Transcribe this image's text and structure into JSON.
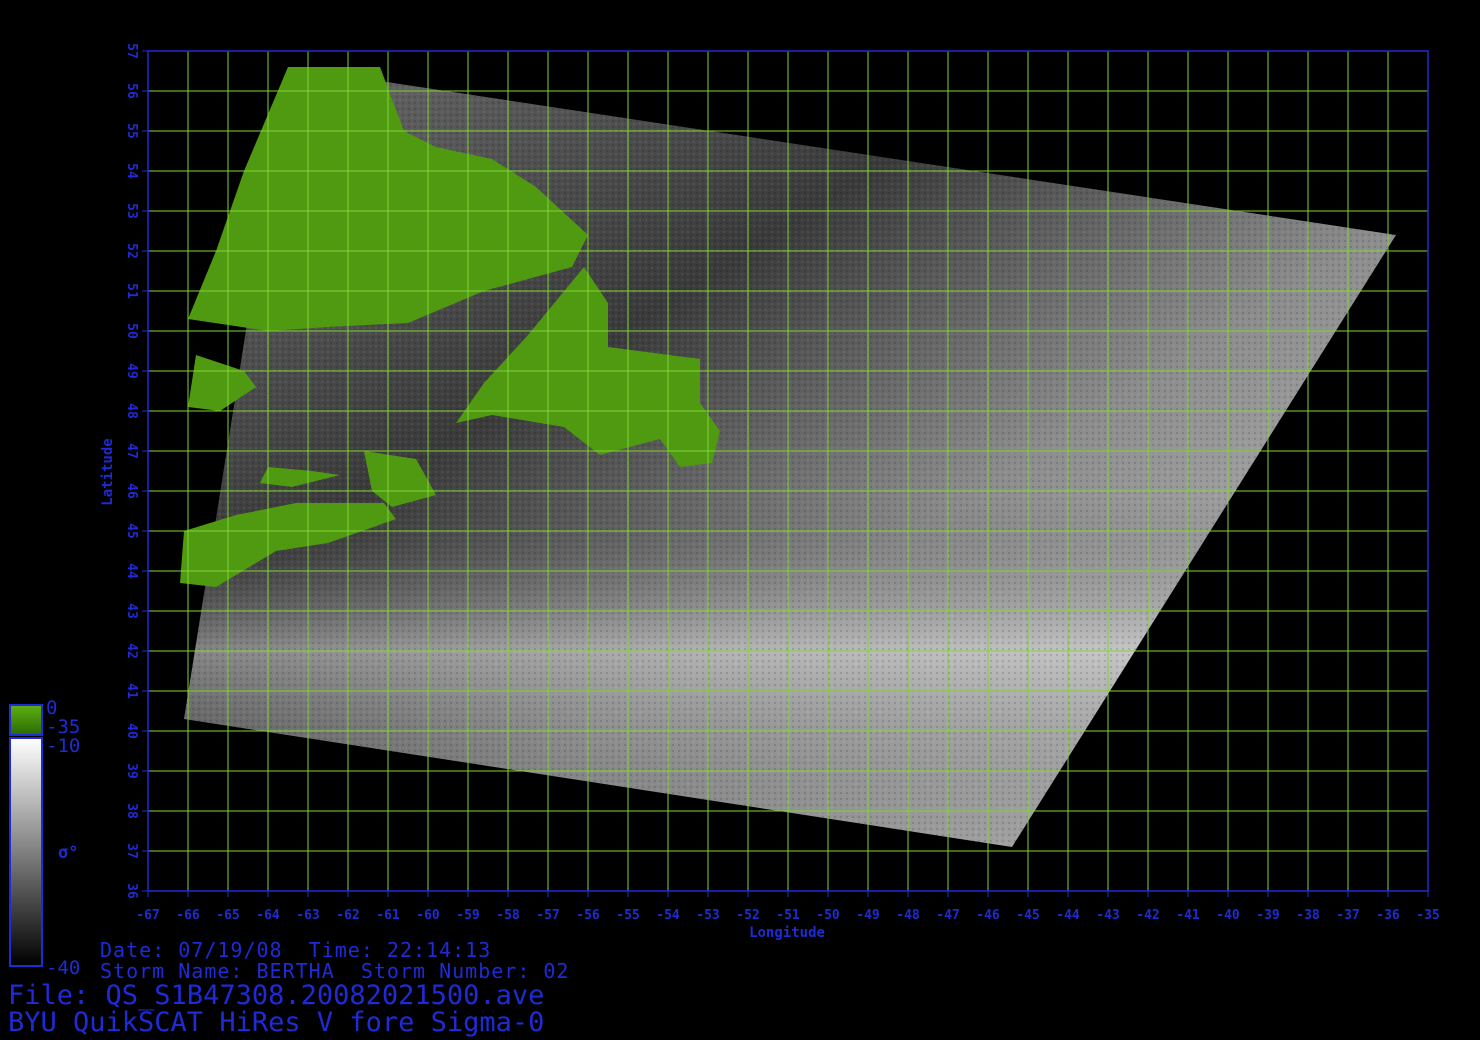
{
  "map": {
    "xlabel": "Longitude",
    "ylabel": "Latitude",
    "lon_range": [
      -67,
      -35
    ],
    "lat_range": [
      36,
      57
    ],
    "lon_ticks": [
      "-67",
      "-66",
      "-65",
      "-64",
      "-63",
      "-62",
      "-61",
      "-60",
      "-59",
      "-58",
      "-57",
      "-56",
      "-55",
      "-54",
      "-53",
      "-52",
      "-51",
      "-50",
      "-49",
      "-48",
      "-47",
      "-46",
      "-45",
      "-44",
      "-43",
      "-42",
      "-41",
      "-40",
      "-39",
      "-38",
      "-37",
      "-36",
      "-35"
    ],
    "lat_ticks": [
      "36",
      "37",
      "38",
      "39",
      "40",
      "41",
      "42",
      "43",
      "44",
      "45",
      "46",
      "47",
      "48",
      "49",
      "50",
      "51",
      "52",
      "53",
      "54",
      "55",
      "56",
      "57"
    ],
    "grid": true,
    "grid_color": "#7fd633",
    "axis_color": "#1e2bd6",
    "land_color": "#4f9a10",
    "swath_corners": [
      {
        "lon": -63.5,
        "lat": 56.6
      },
      {
        "lon": -35.8,
        "lat": 52.4
      },
      {
        "lon": -45.4,
        "lat": 37.1
      },
      {
        "lon": -66.1,
        "lat": 40.3
      }
    ]
  },
  "colorbar": {
    "land_top": "0",
    "land_bottom": "-35",
    "sigma_top": "-10",
    "sigma_bottom": "-40",
    "label": "σ°"
  },
  "info": {
    "date_line": "Date: 07/19/08  Time: 22:14:13",
    "storm_line": "Storm Name: BERTHA  Storm Number: 02",
    "file_line": "File: QS_S1B47308.20082021500.ave",
    "product_line": "BYU QuikSCAT HiRes V fore Sigma-0"
  }
}
